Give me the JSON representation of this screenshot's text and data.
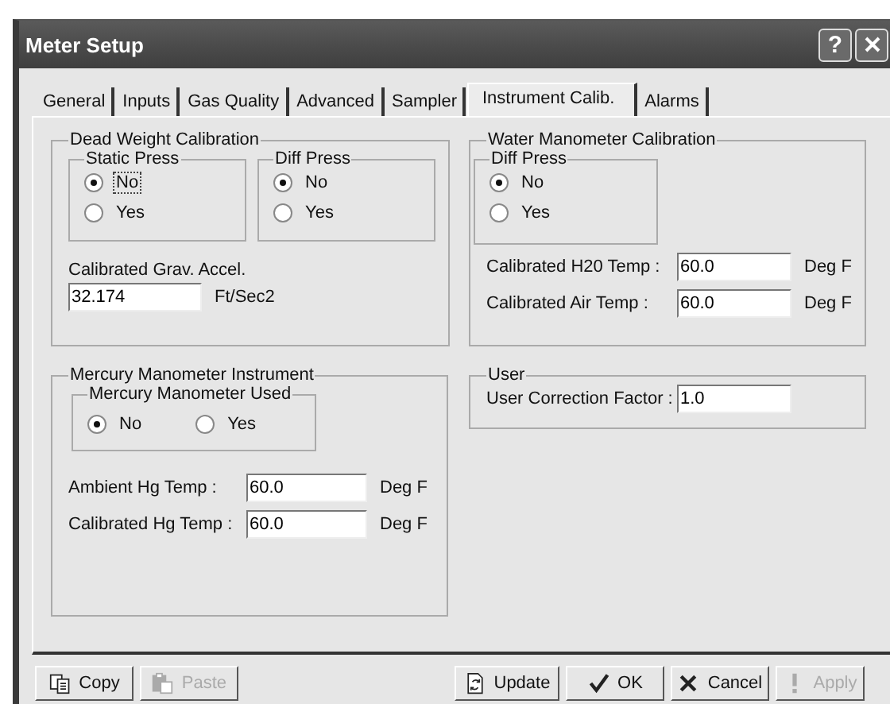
{
  "window": {
    "title": "Meter Setup"
  },
  "title_buttons": [
    {
      "kind": "help",
      "label": "?"
    },
    {
      "kind": "close"
    }
  ],
  "tabs": [
    {
      "label": "General",
      "selected": false
    },
    {
      "label": "Inputs",
      "selected": false
    },
    {
      "label": "Gas Quality",
      "selected": false
    },
    {
      "label": "Advanced",
      "selected": false
    },
    {
      "label": "Sampler",
      "selected": false
    },
    {
      "label": "Instrument Calib.",
      "selected": true
    },
    {
      "label": "Alarms",
      "selected": false
    }
  ],
  "columns": [
    [
      {
        "title": "Dead Weight Calibration",
        "kind": "dead_weight",
        "items": [
          {
            "kind": "radio_groups",
            "groups": [
              {
                "title": "Static Press",
                "kind": "vertical",
                "options": [
                  {
                    "label": "No",
                    "selected": true,
                    "focused": true
                  },
                  {
                    "label": "Yes",
                    "selected": false,
                    "focused": false
                  }
                ]
              },
              {
                "title": "Diff Press",
                "kind": "vertical",
                "options": [
                  {
                    "label": "No",
                    "selected": true,
                    "focused": false
                  },
                  {
                    "label": "Yes",
                    "selected": false,
                    "focused": false
                  }
                ]
              }
            ]
          },
          {
            "kind": "stacked_field",
            "label": "Calibrated Grav. Accel.",
            "value": "32.174",
            "unit": "Ft/Sec2"
          }
        ]
      },
      {
        "title": "Mercury Manometer Instrument",
        "kind": "mercury",
        "items": [
          {
            "kind": "radio_groups",
            "groups": [
              {
                "title": "Mercury Manometer Used",
                "kind": "horizontal",
                "options": [
                  {
                    "label": "No",
                    "selected": true,
                    "focused": false
                  },
                  {
                    "label": "Yes",
                    "selected": false,
                    "focused": false
                  }
                ]
              }
            ]
          },
          {
            "kind": "field",
            "label": "Ambient Hg Temp :",
            "value": "60.0",
            "unit": "Deg F"
          },
          {
            "kind": "field",
            "label": "Calibrated Hg Temp :",
            "value": "60.0",
            "unit": "Deg F"
          }
        ]
      }
    ],
    [
      {
        "title": "Water Manometer Calibration",
        "kind": "water",
        "items": [
          {
            "kind": "radio_groups",
            "groups": [
              {
                "title": "Diff Press",
                "kind": "vertical",
                "options": [
                  {
                    "label": "No",
                    "selected": true,
                    "focused": false
                  },
                  {
                    "label": "Yes",
                    "selected": false,
                    "focused": false
                  }
                ]
              }
            ]
          },
          {
            "kind": "field",
            "label": "Calibrated H20 Temp :",
            "value": "60.0",
            "unit": "Deg F"
          },
          {
            "kind": "field",
            "label": "Calibrated Air Temp :",
            "value": "60.0",
            "unit": "Deg F"
          }
        ]
      },
      {
        "title": "User",
        "kind": "user",
        "items": [
          {
            "kind": "field",
            "label": "User Correction Factor :",
            "value": "1.0"
          }
        ]
      }
    ]
  ],
  "buttons": [
    {
      "kind": "copy",
      "label": "Copy",
      "disabled": false
    },
    {
      "kind": "paste",
      "label": "Paste",
      "disabled": true
    },
    {
      "kind": "update",
      "label": "Update",
      "disabled": false
    },
    {
      "kind": "ok",
      "label": "OK",
      "disabled": false
    },
    {
      "kind": "cancel",
      "label": "Cancel",
      "disabled": false
    },
    {
      "kind": "apply",
      "label": "Apply",
      "disabled": true
    }
  ]
}
